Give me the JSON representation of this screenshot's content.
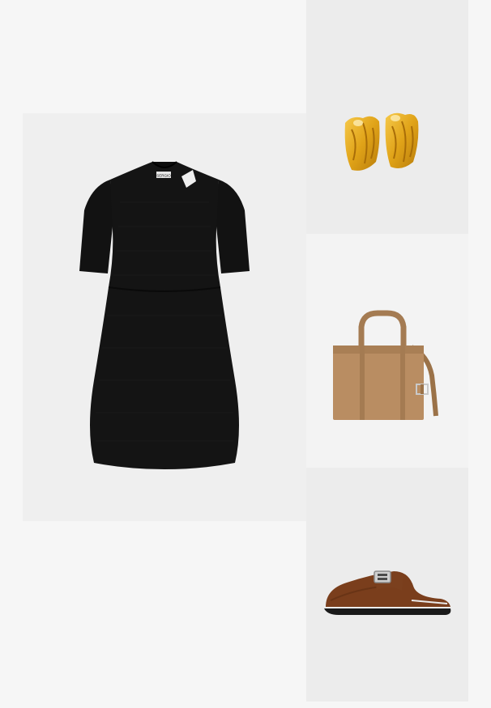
{
  "outfit": {
    "items": [
      {
        "id": "dress",
        "icon": "black-knit-dress-image",
        "label_on_product": "SERGIO",
        "color": "#111111"
      },
      {
        "id": "earrings",
        "icon": "gold-earrings-image",
        "color": "#e3a51b"
      },
      {
        "id": "bag",
        "icon": "tan-tote-bag-image",
        "color": "#b98d62"
      },
      {
        "id": "shoe",
        "icon": "brown-suede-mule-image",
        "color": "#7a3e1c"
      }
    ]
  },
  "colors": {
    "page_background": "#f6f6f6",
    "tile_light": "#f3f3f3",
    "tile_gray": "#ececec"
  }
}
